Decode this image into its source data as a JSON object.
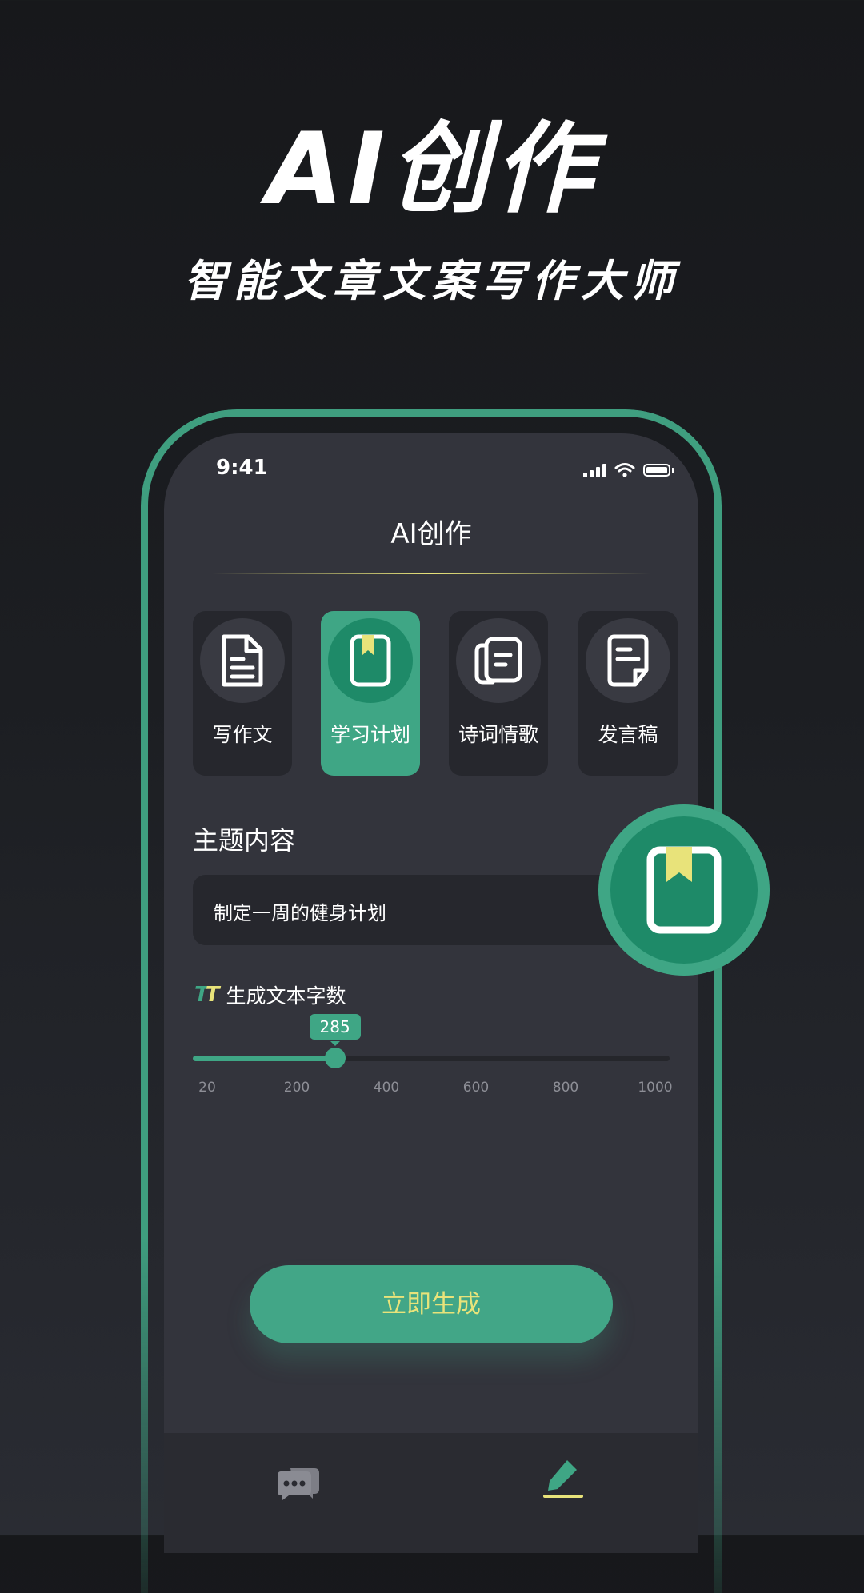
{
  "hero": {
    "title": "AI创作",
    "subtitle": "智能文章文案写作大师"
  },
  "status_bar": {
    "time": "9:41"
  },
  "screen": {
    "title": "AI创作",
    "categories": [
      {
        "label": "写作文",
        "icon": "document-icon",
        "active": false
      },
      {
        "label": "学习计划",
        "icon": "bookmark-book-icon",
        "active": true
      },
      {
        "label": "诗词情歌",
        "icon": "book-scroll-icon",
        "active": false
      },
      {
        "label": "发言稿",
        "icon": "speech-note-icon",
        "active": false
      }
    ],
    "topic": {
      "label": "主题内容",
      "value": "制定一周的健身计划"
    },
    "word_count": {
      "label": "生成文本字数",
      "value": "285",
      "value_num": 285,
      "ticks": [
        "20",
        "200",
        "400",
        "600",
        "800",
        "1000"
      ],
      "tick_values": [
        20,
        200,
        400,
        600,
        800,
        1000
      ]
    },
    "generate_button": "立即生成"
  },
  "tabbar": {
    "items": [
      "chat-icon",
      "write-pen-icon"
    ]
  },
  "colors": {
    "accent": "#3fa685",
    "accent_dark": "#1e8a68",
    "highlight": "#e8e37a",
    "screen_bg": "#33343c",
    "card_bg": "#26272d"
  }
}
